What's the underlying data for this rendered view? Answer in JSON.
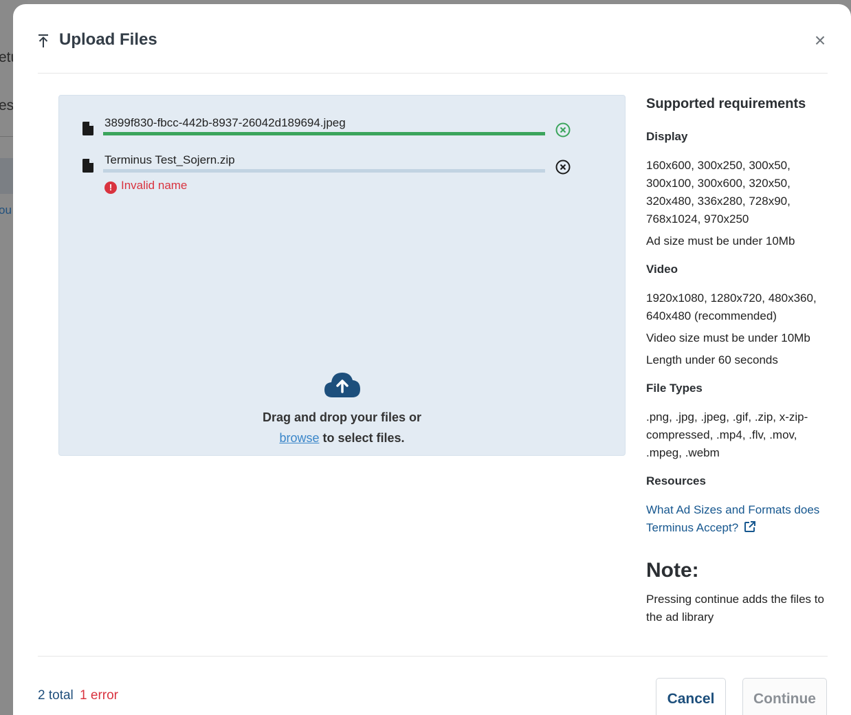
{
  "background": {
    "text_1": "etu",
    "text_2": "es",
    "text_3": "ou"
  },
  "modal": {
    "title": "Upload Files",
    "close_label": "×"
  },
  "files": [
    {
      "name": "3899f830-fbcc-442b-8937-26042d189694.jpeg",
      "progress": 1.0,
      "status": "success",
      "status_color": "#3ba55c"
    },
    {
      "name": "Terminus Test_Sojern.zip",
      "progress": 0.0,
      "status": "error",
      "error": "Invalid name",
      "error_icon": "!"
    }
  ],
  "dropzone": {
    "line1": "Drag and drop your files or",
    "browse": "browse",
    "line2_suffix": " to select files."
  },
  "requirements": {
    "heading": "Supported requirements",
    "display": {
      "title": "Display",
      "sizes": "160x600, 300x250, 300x50, 300x100, 300x600, 320x50, 320x480, 336x280, 728x90, 768x1024, 970x250",
      "limit": "Ad size must be under 10Mb"
    },
    "video": {
      "title": "Video",
      "sizes": "1920x1080, 1280x720, 480x360, 640x480 (recommended)",
      "limit": "Video size must be under 10Mb",
      "length": "Length under 60 seconds"
    },
    "file_types": {
      "title": "File Types",
      "list": ".png, .jpg, .jpeg, .gif, .zip, x-zip-compressed, .mp4, .flv, .mov, .mpeg, .webm"
    },
    "resources": {
      "title": "Resources",
      "link": "What Ad Sizes and Formats does Terminus Accept?"
    },
    "note": {
      "title": "Note:",
      "text": "Pressing continue adds the files to the ad library"
    }
  },
  "footer": {
    "total": "2 total",
    "errors": "1 error",
    "cancel": "Cancel",
    "continue": "Continue"
  },
  "colors": {
    "accent": "#16578f",
    "success": "#3ba55c",
    "error": "#d9333f",
    "dropzone_bg": "#e3ebf3"
  }
}
